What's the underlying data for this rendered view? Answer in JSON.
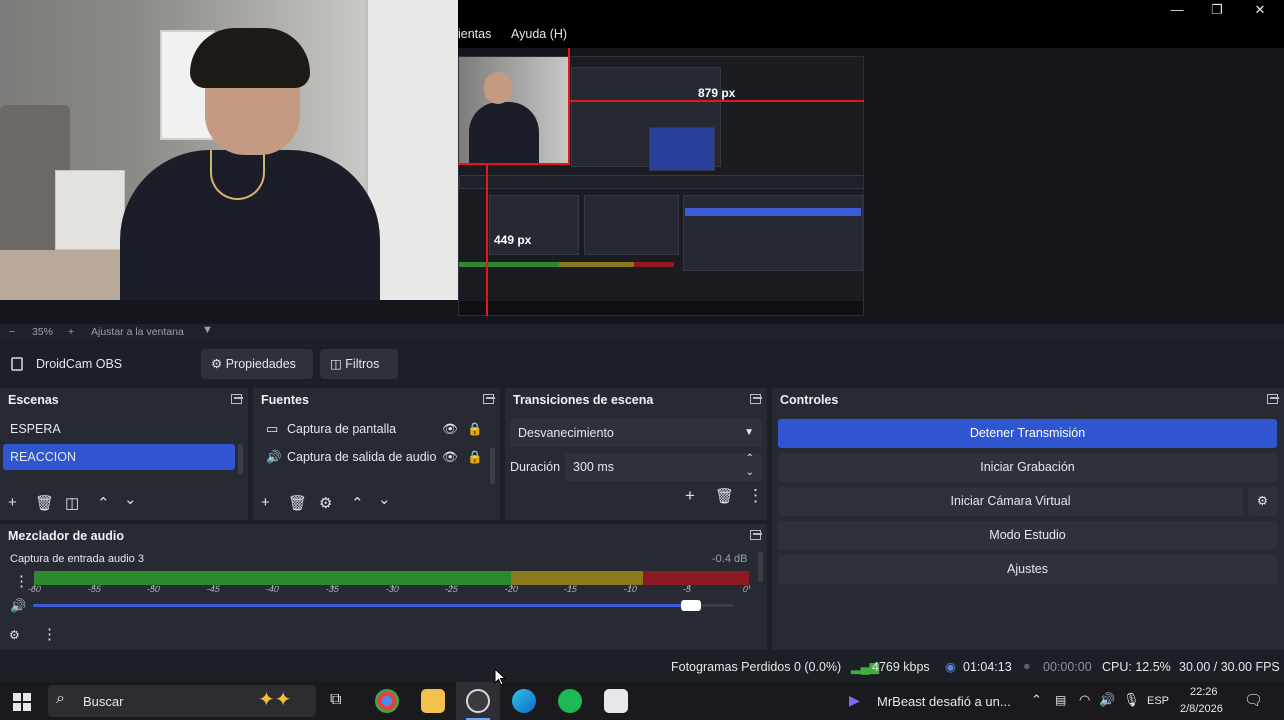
{
  "menu": {
    "partial_item": "ientas",
    "help": "Ayuda (H)"
  },
  "window": {
    "minimize": "—",
    "restore": "❐",
    "close": "✕"
  },
  "preview": {
    "measure_h": "879 px",
    "measure_v": "449 px"
  },
  "zoom": {
    "minus": "−",
    "level": "35%",
    "plus": "+",
    "fit": "Ajustar a la ventana"
  },
  "source_bar": {
    "source_name": "DroidCam OBS",
    "properties": "Propiedades",
    "filters": "Filtros"
  },
  "scenes": {
    "title": "Escenas",
    "items": [
      {
        "label": "ESPERA"
      },
      {
        "label": "REACCION"
      }
    ]
  },
  "sources": {
    "title": "Fuentes",
    "items": [
      {
        "label": "Captura de pantalla"
      },
      {
        "label": "Captura de salida de audio"
      }
    ]
  },
  "transitions": {
    "title": "Transiciones de escena",
    "selected": "Desvanecimiento",
    "duration_label": "Duración",
    "duration_value": "300 ms"
  },
  "controls": {
    "title": "Controles",
    "buttons": [
      {
        "label": "Detener Transmisión"
      },
      {
        "label": "Iniciar Grabación"
      },
      {
        "label": "Iniciar Cámara Virtual"
      },
      {
        "label": "Modo Estudio"
      },
      {
        "label": "Ajustes"
      }
    ]
  },
  "mixer": {
    "title": "Mezclador de audio",
    "channel": "Captura de entrada audio 3",
    "db": "-0.4 dB",
    "volume_fraction": 0.94,
    "ticks": [
      "-60",
      "-55",
      "-50",
      "-45",
      "-40",
      "-35",
      "-30",
      "-25",
      "-20",
      "-15",
      "-10",
      "-5",
      "0"
    ]
  },
  "status": {
    "dropped": "Fotogramas Perdidos 0 (0.0%)",
    "bitrate": "4769 kbps",
    "stream_time": "01:04:13",
    "rec_time": "00:00:00",
    "cpu": "CPU: 12.5%",
    "fps": "30.00 / 30.00 FPS"
  },
  "taskbar": {
    "search": "Buscar",
    "news": "MrBeast desafió a un...",
    "lang": "ESP",
    "time": "22:26",
    "date": "2/8/2026"
  },
  "colors": {
    "accent": "#2f55d1",
    "meter_green": "#2c8a2c",
    "meter_yellow": "#8a7a1c",
    "meter_red": "#8c1a22",
    "measure_red": "#e0191f"
  }
}
